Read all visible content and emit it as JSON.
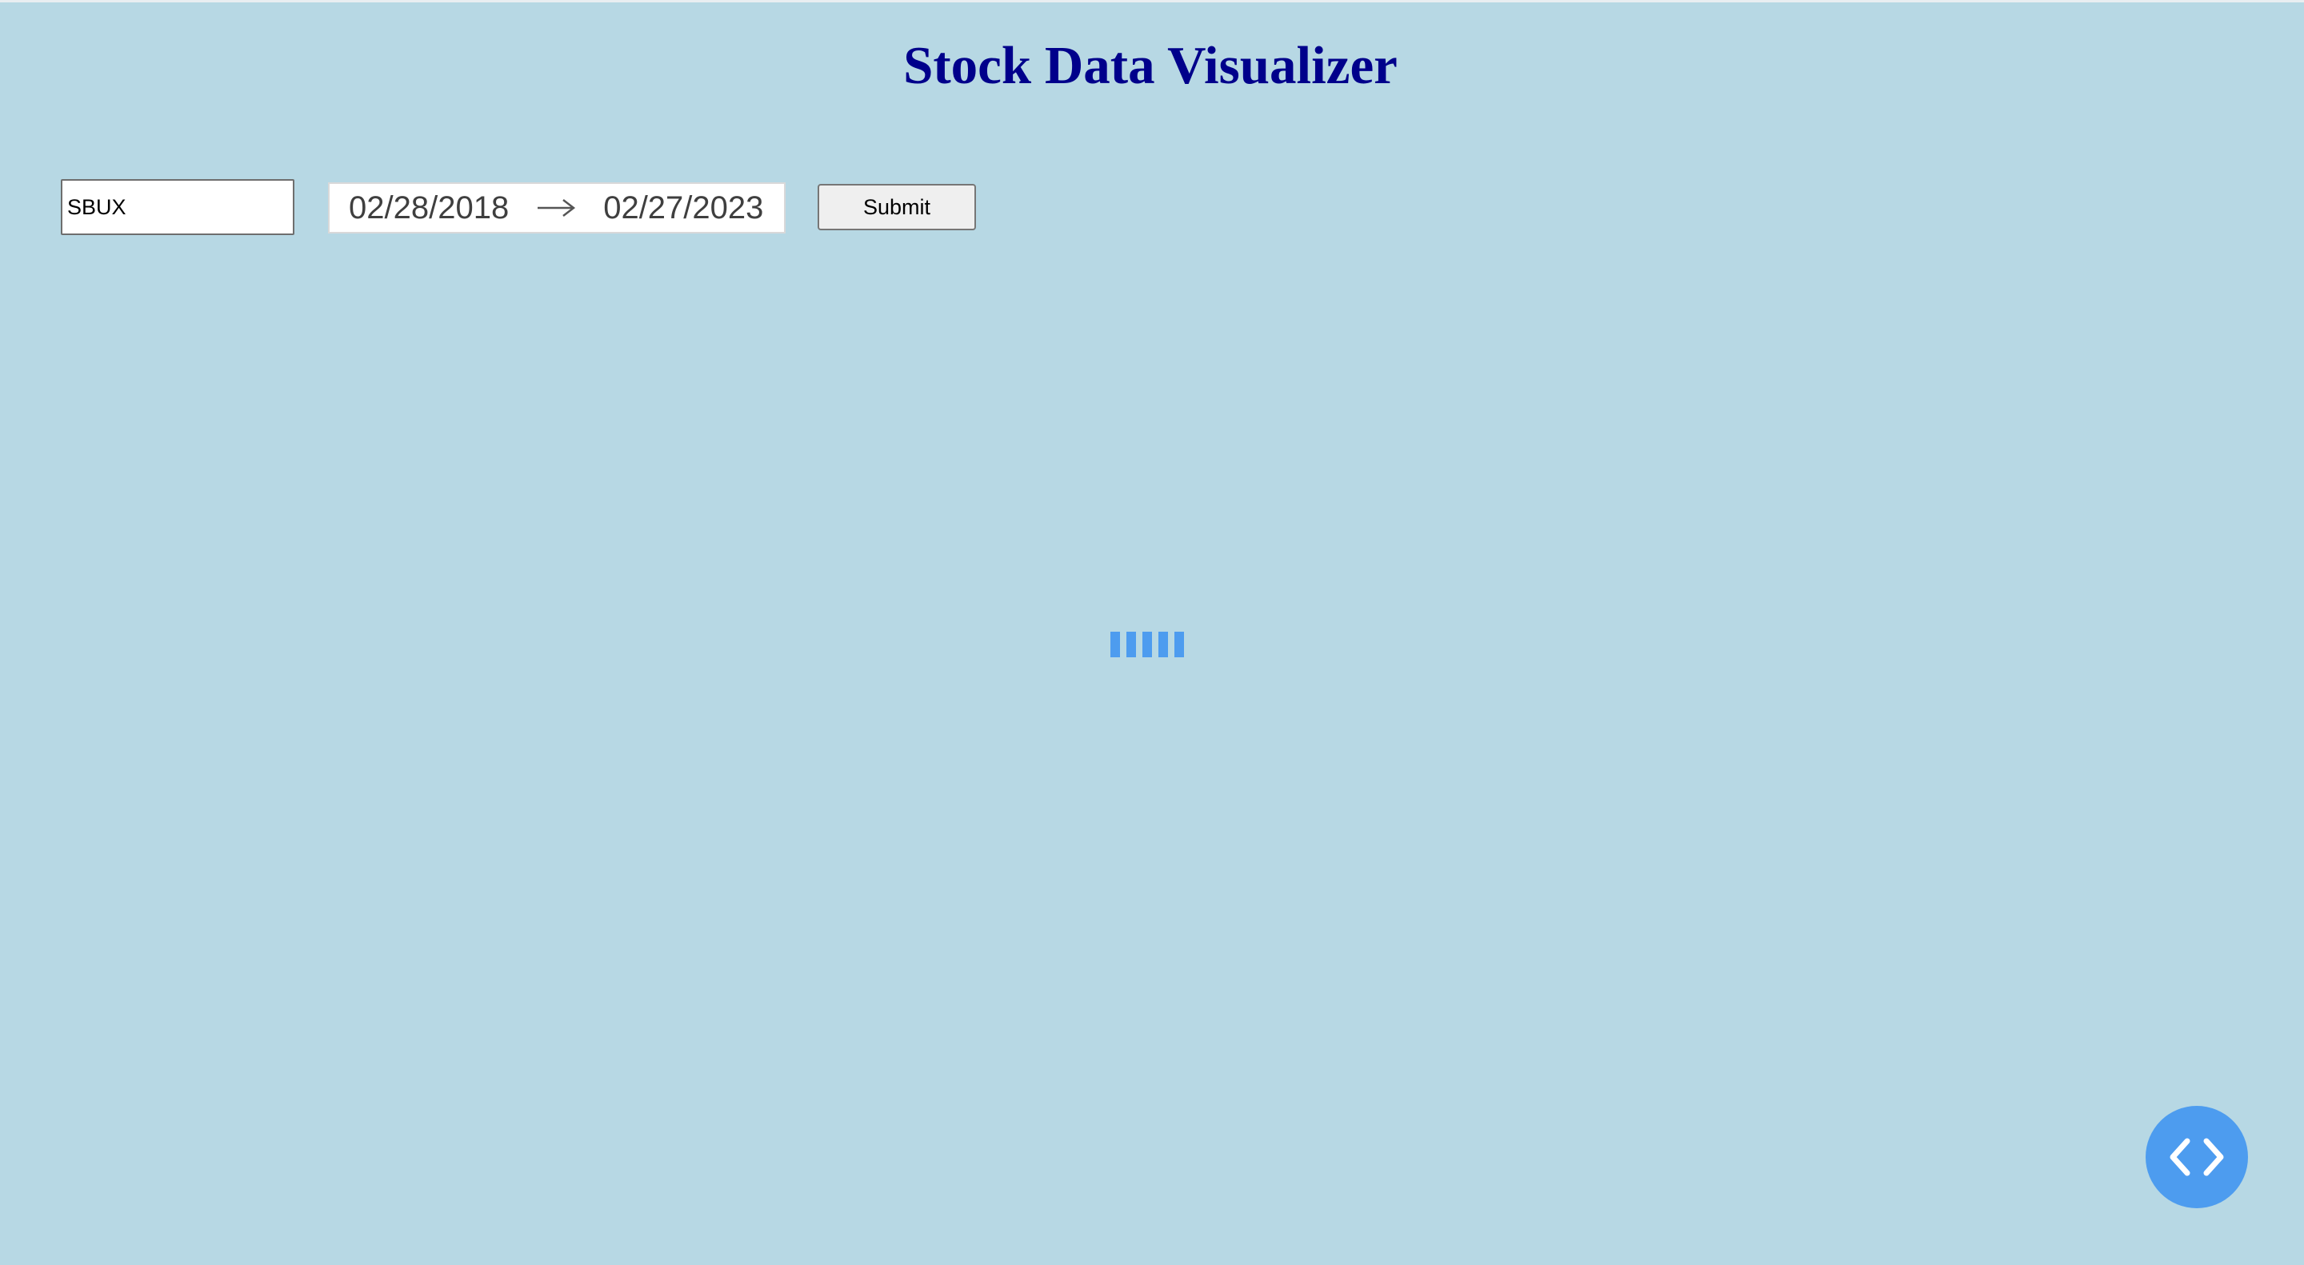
{
  "page": {
    "title": "Stock Data Visualizer"
  },
  "form": {
    "ticker_value": "SBUX",
    "date_range": {
      "start": "02/28/2018",
      "end": "02/27/2023",
      "separator_icon": "arrow-right-icon"
    },
    "submit_label": "Submit"
  },
  "loading": {
    "icon": "loading-bars-icon",
    "bar_count": 5
  },
  "fab": {
    "icon": "code-icon"
  },
  "colors": {
    "background": "#b7d8e4",
    "title": "#00008b",
    "accent": "#4d9cef"
  }
}
